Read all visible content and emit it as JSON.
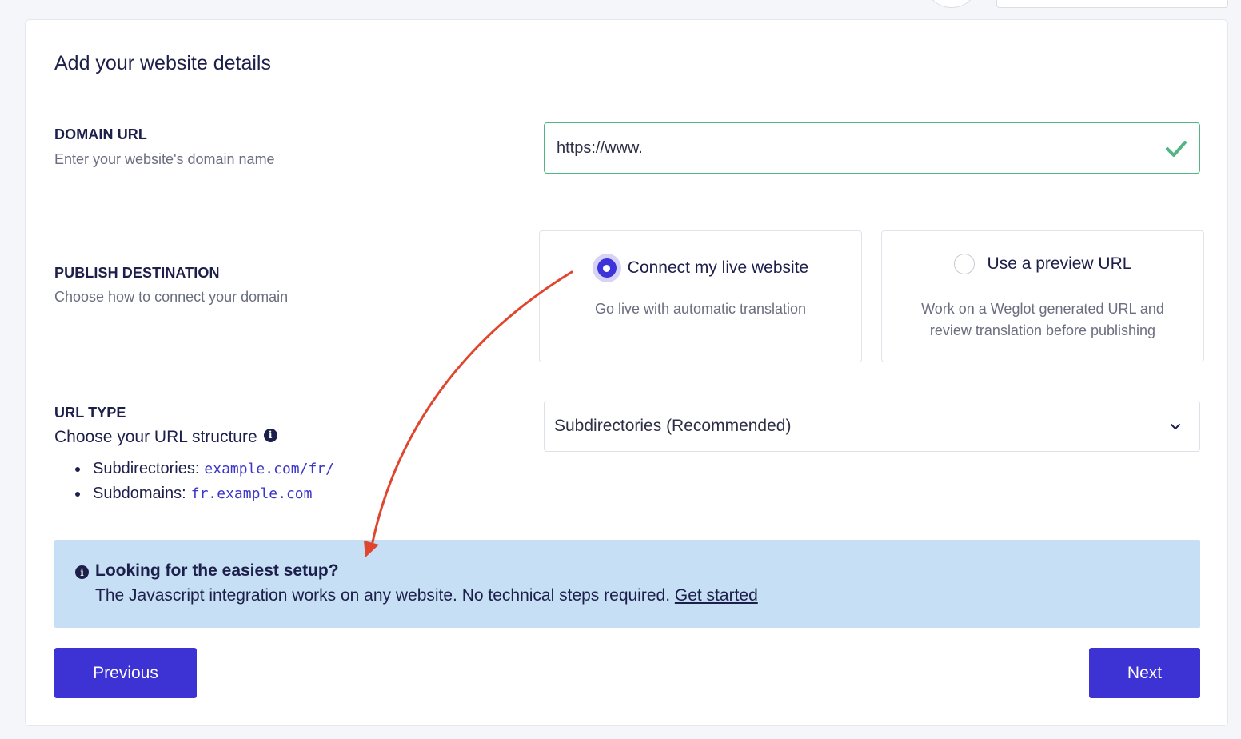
{
  "page": {
    "title": "Add your website details"
  },
  "domain": {
    "label": "DOMAIN URL",
    "description": "Enter your website's domain name",
    "value": "https://www."
  },
  "publish": {
    "label": "PUBLISH DESTINATION",
    "description": "Choose how to connect your domain",
    "options": [
      {
        "label": "Connect my live website",
        "description": "Go live with automatic translation",
        "selected": true
      },
      {
        "label": "Use a preview URL",
        "description_line1": "Work on a Weglot generated URL and",
        "description_line2": "review translation before publishing",
        "selected": false
      }
    ]
  },
  "url_type": {
    "label": "URL TYPE",
    "description": "Choose your URL structure",
    "selected": "Subdirectories (Recommended)",
    "examples": [
      {
        "name": "Subdirectories:",
        "example": "example.com/fr/"
      },
      {
        "name": "Subdomains:",
        "example": "fr.example.com"
      }
    ]
  },
  "notice": {
    "title": "Looking for the easiest setup?",
    "body": "The Javascript integration works on any website. No technical steps required.",
    "link": "Get started"
  },
  "buttons": {
    "previous": "Previous",
    "next": "Next"
  },
  "colors": {
    "primary": "#3d33d5",
    "success": "#54b584",
    "notice_bg": "#c6dff5",
    "annotation_arrow": "#e0462f"
  },
  "icons": {
    "domain_valid": "check-icon",
    "select": "chevron-down-icon",
    "info": "info-icon"
  }
}
